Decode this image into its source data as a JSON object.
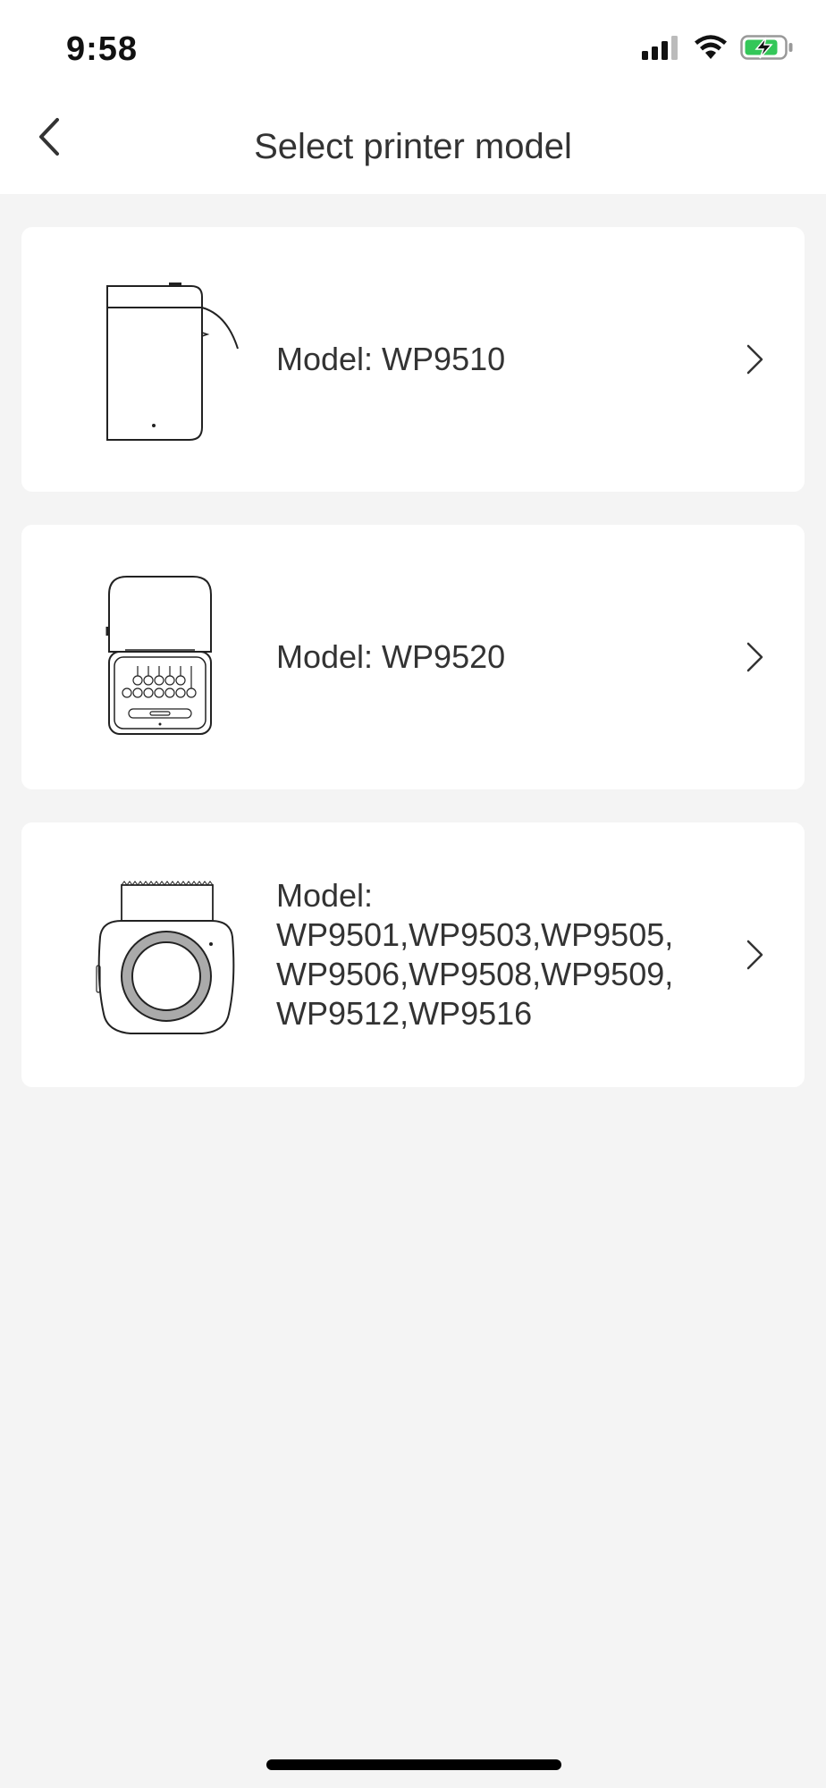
{
  "status_bar": {
    "time": "9:58"
  },
  "header": {
    "title": "Select printer model"
  },
  "models": [
    {
      "label": "Model: WP9510",
      "image": "printer-wp9510-icon"
    },
    {
      "label": "Model: WP9520",
      "image": "printer-wp9520-icon"
    },
    {
      "label": "Model: WP9501,WP9503,WP9505, WP9506,WP9508,WP9509, WP9512,WP9516",
      "image": "printer-round-icon",
      "label_lines": [
        "Model:",
        "WP9501,WP9503,WP9505,",
        "WP9506,WP9508,WP9509,",
        "WP9512,WP9516"
      ]
    }
  ],
  "colors": {
    "background": "#f4f4f4",
    "card": "#ffffff",
    "text": "#333333",
    "battery": "#34c759"
  }
}
